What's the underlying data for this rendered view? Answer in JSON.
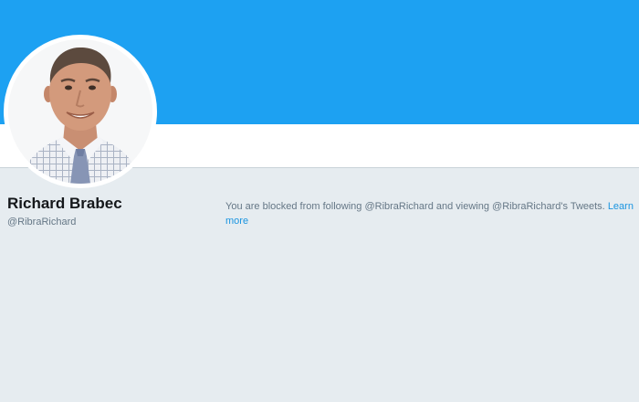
{
  "colors": {
    "banner": "#1da1f2",
    "page_background": "#e6ecf0",
    "link": "#1b95e0",
    "text_primary": "#14171a",
    "text_secondary": "#657786"
  },
  "profile": {
    "display_name": "Richard Brabec",
    "handle": "@RibraRichard",
    "avatar_icon": "profile-photo"
  },
  "blocked_notice": {
    "message": "You are blocked from following @RibraRichard and viewing @RibraRichard's Tweets.",
    "link_label": "Learn more"
  }
}
